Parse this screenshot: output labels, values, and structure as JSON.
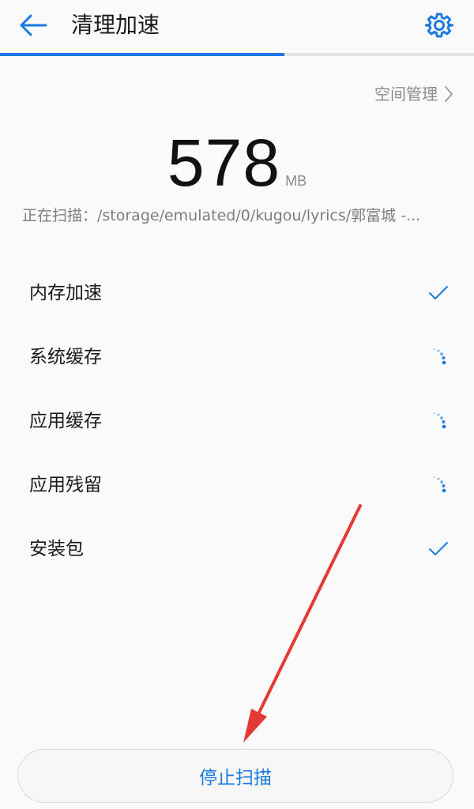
{
  "header": {
    "title": "清理加速",
    "back_icon": "arrow-left-icon",
    "settings_icon": "gear-icon"
  },
  "progress": {
    "fraction": 0.6
  },
  "space_management": {
    "label": "空间管理",
    "icon": "chevron-right-icon"
  },
  "junk_size": {
    "value": "578",
    "unit": "MB"
  },
  "scan_status": "正在扫描：/storage/emulated/0/kugou/lyrics/郭富城 -...",
  "tasks": [
    {
      "label": "内存加速",
      "status": "done"
    },
    {
      "label": "系统缓存",
      "status": "scanning"
    },
    {
      "label": "应用缓存",
      "status": "scanning"
    },
    {
      "label": "应用残留",
      "status": "scanning"
    },
    {
      "label": "安装包",
      "status": "done"
    }
  ],
  "stop_button": {
    "label": "停止扫描"
  },
  "colors": {
    "accent": "#1a7ae0",
    "background": "#fafafa",
    "annotation": "#e53935"
  }
}
